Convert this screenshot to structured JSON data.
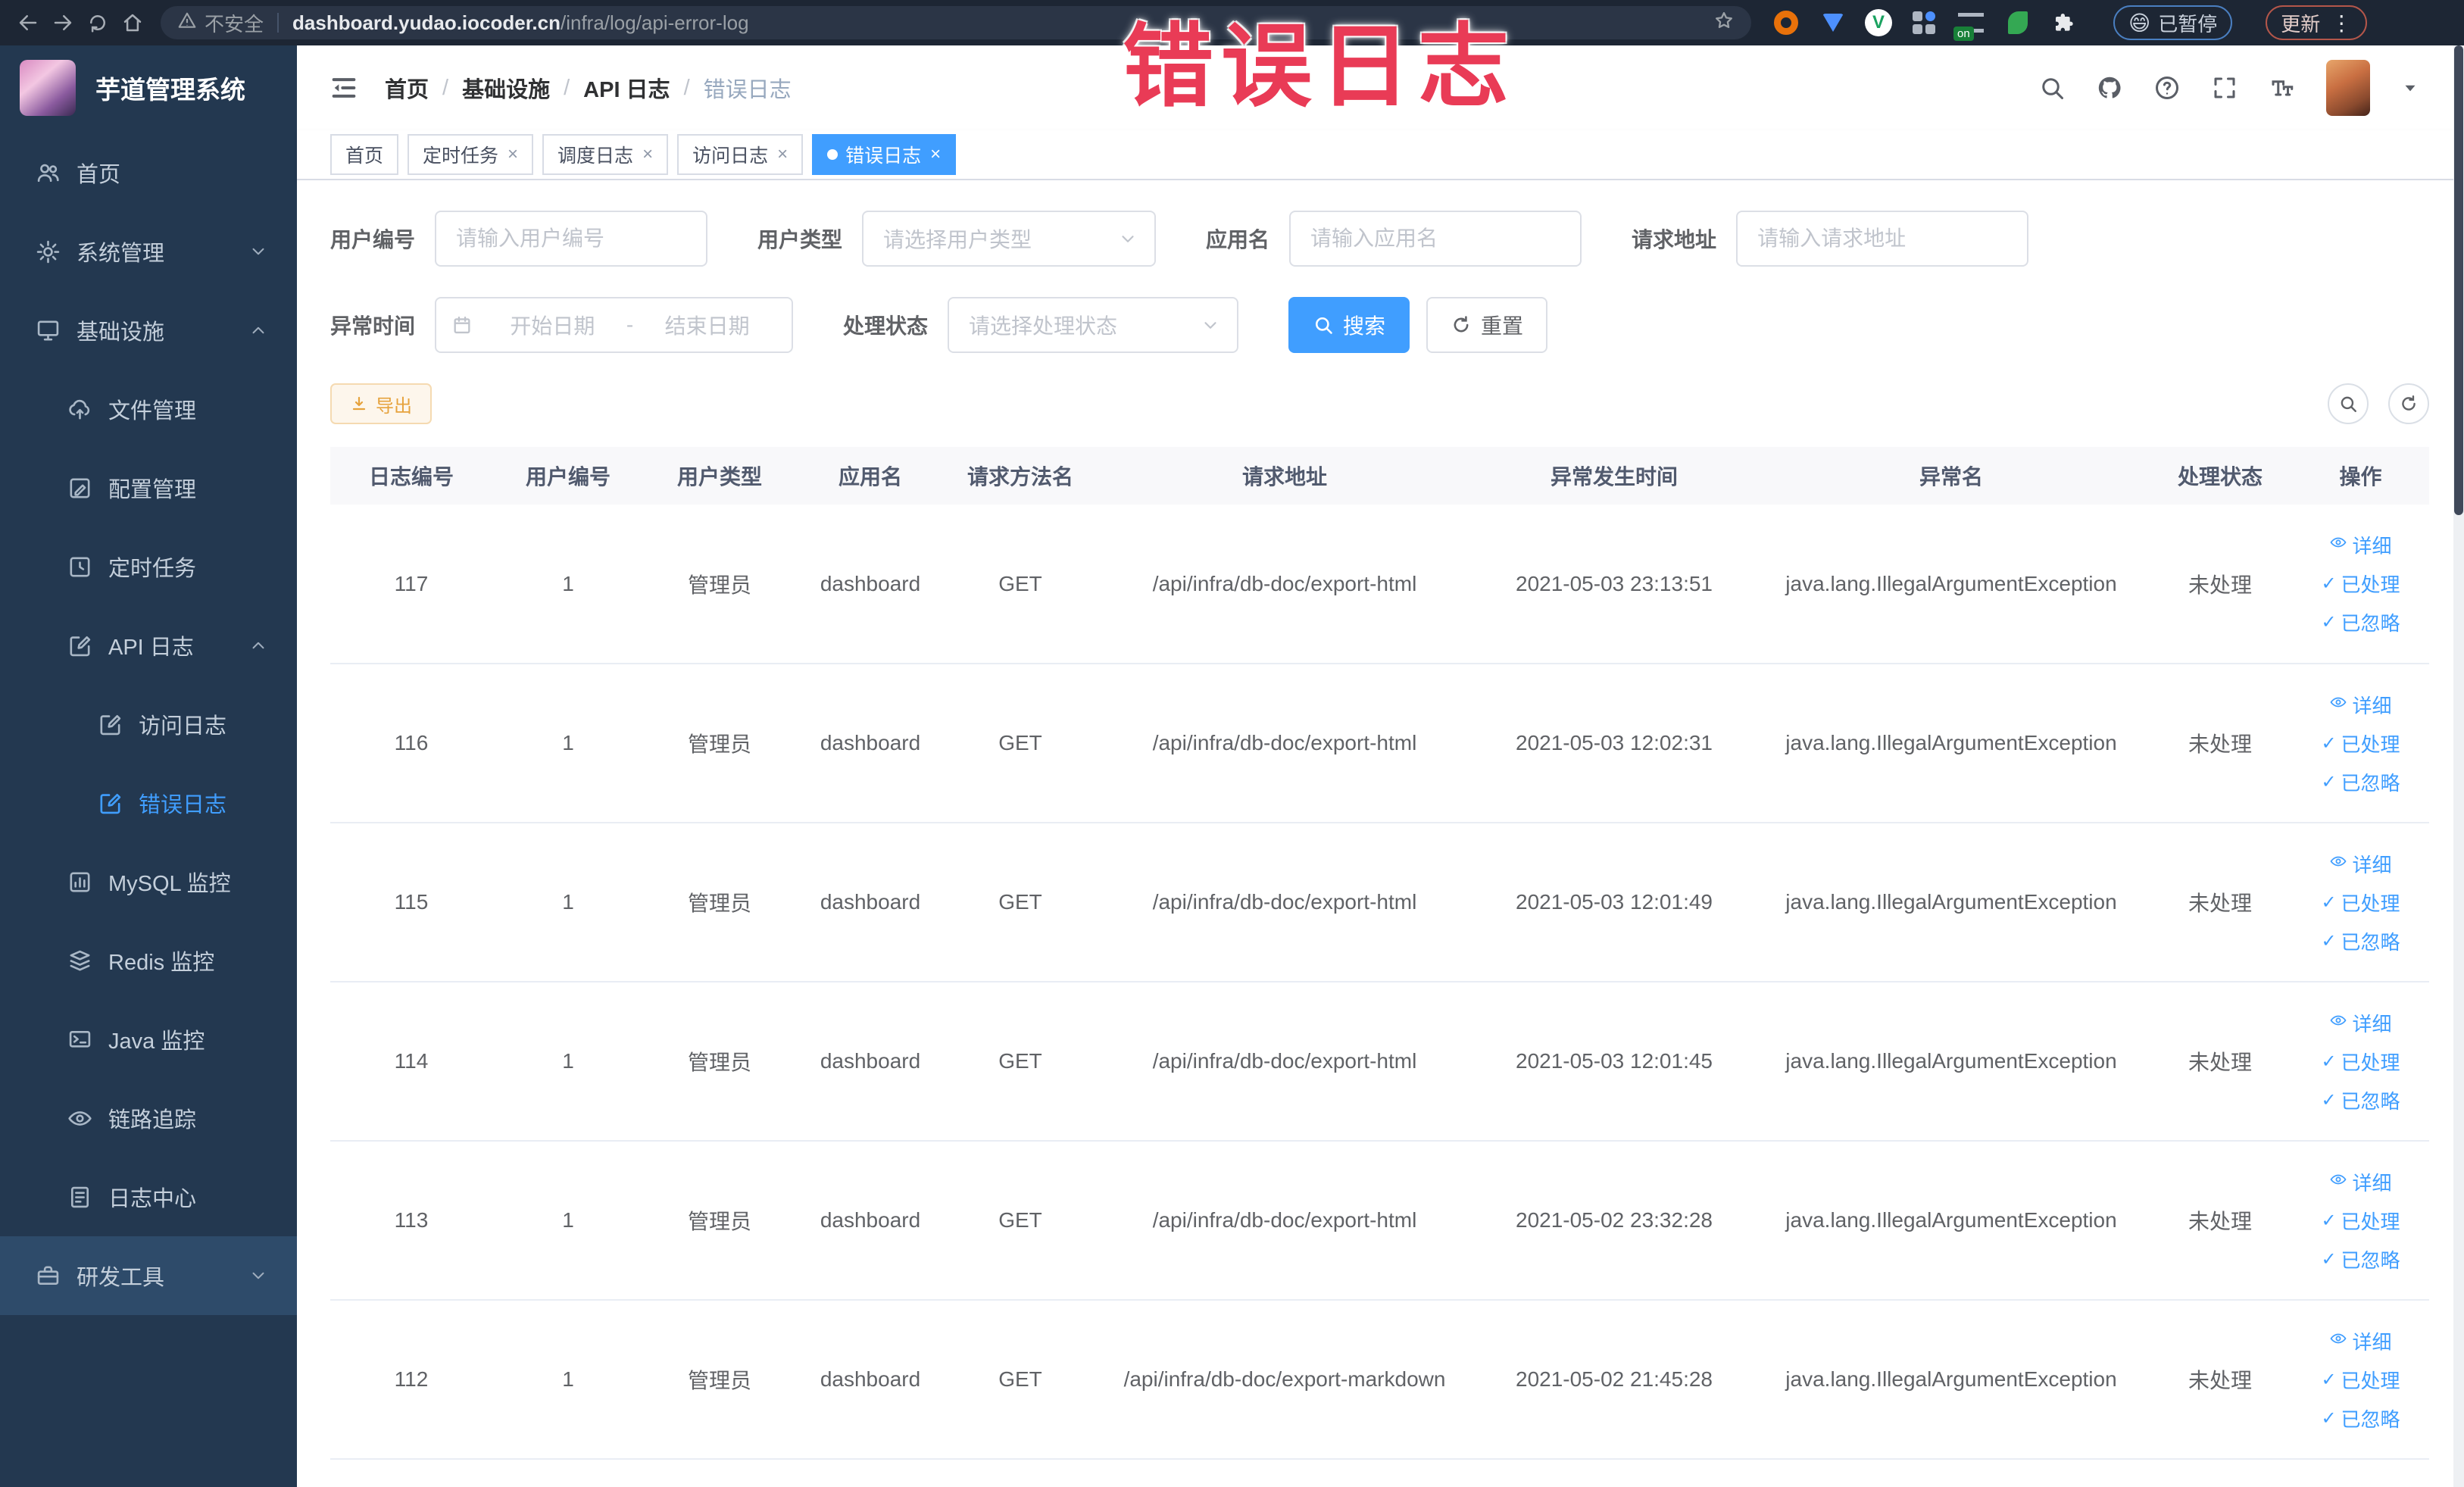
{
  "browser": {
    "security_label": "不安全",
    "url_domain": "dashboard.yudao.iocoder.cn",
    "url_path": "/infra/log/api-error-log",
    "extension_on_badge": "on",
    "paused_badge": "已暂停",
    "paused_emoji": "😄",
    "update_badge": "更新",
    "kebab": "⋮"
  },
  "overlay": {
    "text": "错误日志",
    "color": "#e93b56"
  },
  "sidebar": {
    "logo_title": "芋道管理系统",
    "items": [
      {
        "label": "首页",
        "icon": "peoples",
        "level": 0
      },
      {
        "label": "系统管理",
        "icon": "gear",
        "level": 0,
        "arrow": "down"
      },
      {
        "label": "基础设施",
        "icon": "infra",
        "level": 0,
        "arrow": "up"
      },
      {
        "label": "文件管理",
        "icon": "file",
        "level": 1
      },
      {
        "label": "配置管理",
        "icon": "config",
        "level": 1
      },
      {
        "label": "定时任务",
        "icon": "cron",
        "level": 1
      },
      {
        "label": "API 日志",
        "icon": "log",
        "level": 1,
        "arrow": "up"
      },
      {
        "label": "访问日志",
        "icon": "log",
        "level": 2
      },
      {
        "label": "错误日志",
        "icon": "log",
        "level": 2,
        "active": true
      },
      {
        "label": "MySQL 监控",
        "icon": "mysql",
        "level": 1
      },
      {
        "label": "Redis 监控",
        "icon": "redis",
        "level": 1
      },
      {
        "label": "Java 监控",
        "icon": "java",
        "level": 1
      },
      {
        "label": "链路追踪",
        "icon": "trace",
        "level": 1
      },
      {
        "label": "日志中心",
        "icon": "logcenter",
        "level": 1
      },
      {
        "label": "研发工具",
        "icon": "tools",
        "level": 0,
        "arrow": "down",
        "hover": true
      }
    ]
  },
  "header": {
    "breadcrumb": [
      "首页",
      "基础设施",
      "API 日志",
      "错误日志"
    ]
  },
  "tabs": [
    {
      "label": "首页",
      "closable": false,
      "active": false
    },
    {
      "label": "定时任务",
      "closable": true,
      "active": false
    },
    {
      "label": "调度日志",
      "closable": true,
      "active": false
    },
    {
      "label": "访问日志",
      "closable": true,
      "active": false
    },
    {
      "label": "错误日志",
      "closable": true,
      "active": true
    }
  ],
  "filters": {
    "user_id": {
      "label": "用户编号",
      "placeholder": "请输入用户编号"
    },
    "user_type": {
      "label": "用户类型",
      "placeholder": "请选择用户类型"
    },
    "app_name": {
      "label": "应用名",
      "placeholder": "请输入应用名"
    },
    "request_url": {
      "label": "请求地址",
      "placeholder": "请输入请求地址"
    },
    "exception_time": {
      "label": "异常时间",
      "start_placeholder": "开始日期",
      "separator": "-",
      "end_placeholder": "结束日期"
    },
    "process_status": {
      "label": "处理状态",
      "placeholder": "请选择处理状态"
    },
    "search_label": "搜索",
    "reset_label": "重置"
  },
  "toolbar": {
    "export_label": "导出"
  },
  "table": {
    "columns": [
      "日志编号",
      "用户编号",
      "用户类型",
      "应用名",
      "请求方法名",
      "请求地址",
      "异常发生时间",
      "异常名",
      "处理状态",
      "操作"
    ],
    "actions": {
      "detail": "详细",
      "processed": "已处理",
      "ignored": "已忽略"
    },
    "rows": [
      {
        "id": "117",
        "user_id": "1",
        "user_type": "管理员",
        "app_name": "dashboard",
        "method": "GET",
        "url": "/api/infra/db-doc/export-html",
        "time": "2021-05-03 23:13:51",
        "exception": "java.lang.IllegalArgumentException",
        "status": "未处理"
      },
      {
        "id": "116",
        "user_id": "1",
        "user_type": "管理员",
        "app_name": "dashboard",
        "method": "GET",
        "url": "/api/infra/db-doc/export-html",
        "time": "2021-05-03 12:02:31",
        "exception": "java.lang.IllegalArgumentException",
        "status": "未处理"
      },
      {
        "id": "115",
        "user_id": "1",
        "user_type": "管理员",
        "app_name": "dashboard",
        "method": "GET",
        "url": "/api/infra/db-doc/export-html",
        "time": "2021-05-03 12:01:49",
        "exception": "java.lang.IllegalArgumentException",
        "status": "未处理"
      },
      {
        "id": "114",
        "user_id": "1",
        "user_type": "管理员",
        "app_name": "dashboard",
        "method": "GET",
        "url": "/api/infra/db-doc/export-html",
        "time": "2021-05-03 12:01:45",
        "exception": "java.lang.IllegalArgumentException",
        "status": "未处理"
      },
      {
        "id": "113",
        "user_id": "1",
        "user_type": "管理员",
        "app_name": "dashboard",
        "method": "GET",
        "url": "/api/infra/db-doc/export-html",
        "time": "2021-05-02 23:32:28",
        "exception": "java.lang.IllegalArgumentException",
        "status": "未处理"
      },
      {
        "id": "112",
        "user_id": "1",
        "user_type": "管理员",
        "app_name": "dashboard",
        "method": "GET",
        "url": "/api/infra/db-doc/export-markdown",
        "time": "2021-05-02 21:45:28",
        "exception": "java.lang.IllegalArgumentException",
        "status": "未处理"
      }
    ]
  },
  "colors": {
    "accent": "#409eff",
    "warning": "#e6a23c",
    "overlay_red": "#e93b56",
    "sidebar_bg": "#233850",
    "chrome_bg": "#1d2634"
  }
}
